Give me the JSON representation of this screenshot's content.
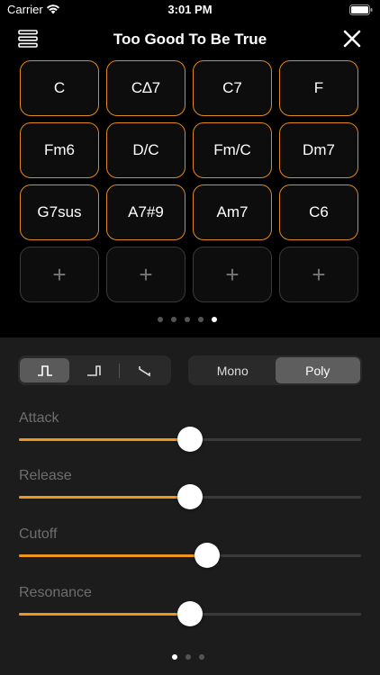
{
  "status": {
    "carrier": "Carrier",
    "time": "3:01 PM"
  },
  "header": {
    "title": "Too Good To Be True"
  },
  "chords": {
    "rows": [
      [
        "C",
        "C∆7",
        "C7",
        "F"
      ],
      [
        "Fm6",
        "D/C",
        "Fm/C",
        "Dm7"
      ],
      [
        "G7sus",
        "A7#9",
        "Am7",
        "C6"
      ],
      [
        "+",
        "+",
        "+",
        "+"
      ]
    ]
  },
  "modes": {
    "mono": "Mono",
    "poly": "Poly",
    "selected": "Poly"
  },
  "sliders": {
    "attack": {
      "label": "Attack",
      "value": 0.5
    },
    "release": {
      "label": "Release",
      "value": 0.5
    },
    "cutoff": {
      "label": "Cutoff",
      "value": 0.55
    },
    "resonance": {
      "label": "Resonance",
      "value": 0.5
    }
  },
  "pager_top": {
    "count": 5,
    "active": 4
  },
  "pager_bottom": {
    "count": 3,
    "active": 0
  },
  "colors": {
    "accent": "#f0961e",
    "cell_border": "#e08a20",
    "empty_border": "#3a3a3a",
    "panel_bg": "#1c1c1c"
  },
  "icons": {
    "menu": "menu-icon",
    "close": "close-icon",
    "wifi": "wifi-icon",
    "battery": "battery-icon",
    "square": "square-wave-icon",
    "pulse": "pulse-wave-icon",
    "saw": "sawtooth-wave-icon"
  }
}
